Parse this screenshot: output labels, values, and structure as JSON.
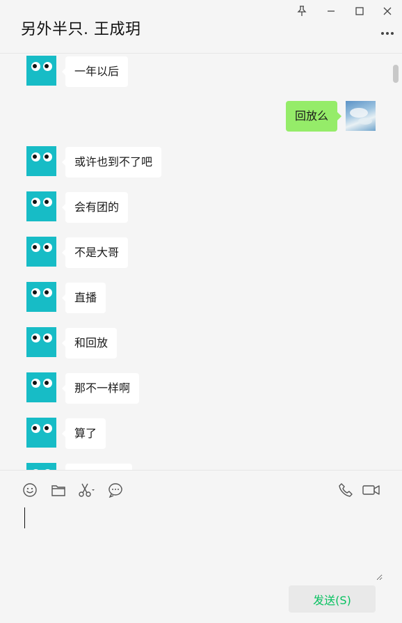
{
  "header": {
    "title": "另外半只. 王成玥"
  },
  "window_controls": [
    "pin-icon",
    "minimize-icon",
    "maximize-icon",
    "close-icon"
  ],
  "messages": [
    {
      "direction": "in",
      "text": "一年以后"
    },
    {
      "direction": "out",
      "text": "回放么"
    },
    {
      "direction": "in",
      "text": "或许也到不了吧"
    },
    {
      "direction": "in",
      "text": "会有团的"
    },
    {
      "direction": "in",
      "text": "不是大哥"
    },
    {
      "direction": "in",
      "text": "直播"
    },
    {
      "direction": "in",
      "text": "和回放"
    },
    {
      "direction": "in",
      "text": "那不一样啊"
    },
    {
      "direction": "in",
      "text": "算了"
    },
    {
      "direction": "in",
      "text": ""
    }
  ],
  "toolbar": {
    "icons": [
      "emoji-icon",
      "folder-icon",
      "scissors-icon",
      "chat-history-icon",
      "phone-icon",
      "video-icon"
    ]
  },
  "input": {
    "value": ""
  },
  "send_label": "发送(S)",
  "colors": {
    "background": "#f5f5f5",
    "avatar": "#17bcc6",
    "outgoing_bubble": "#95ec69",
    "send_text": "#07c160"
  }
}
